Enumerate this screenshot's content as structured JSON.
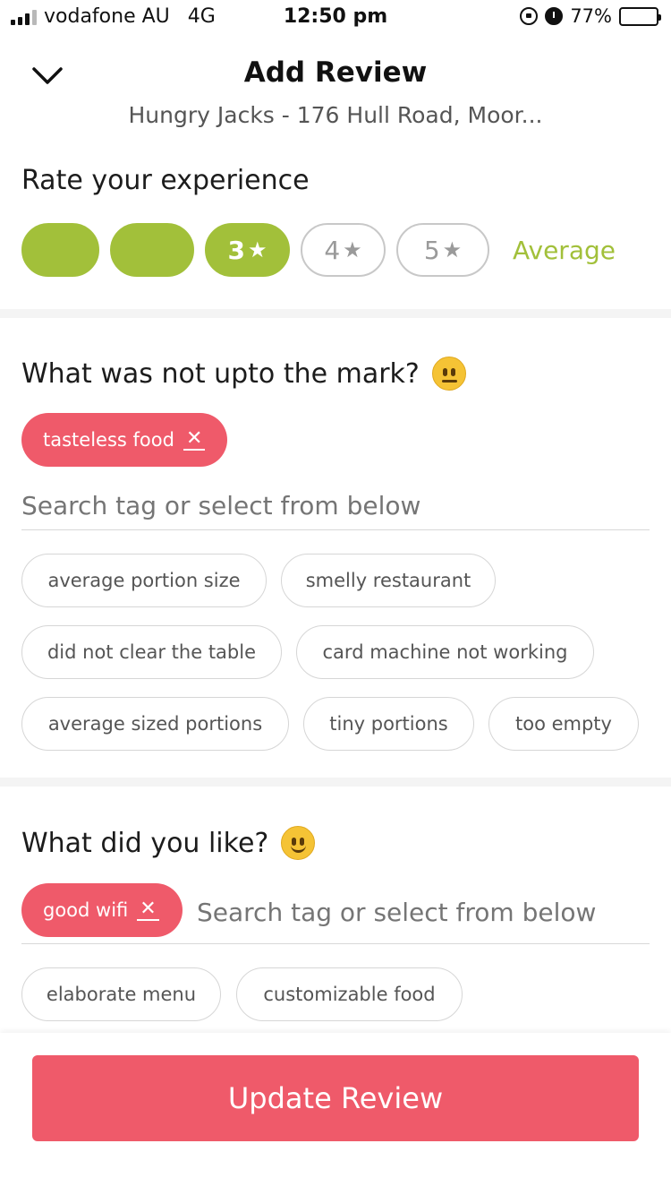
{
  "status_bar": {
    "carrier": "vodafone AU",
    "network": "4G",
    "time": "12:50 pm",
    "battery": "77%",
    "battery_level": 0.77
  },
  "header": {
    "title": "Add Review",
    "subtitle": "Hungry Jacks - 176 Hull Road, Moor..."
  },
  "rating": {
    "heading": "Rate your experience",
    "pills": [
      {
        "label": "",
        "filled": true
      },
      {
        "label": "",
        "filled": true
      },
      {
        "label": "3",
        "filled": true
      },
      {
        "label": "4",
        "filled": false
      },
      {
        "label": "5",
        "filled": false
      }
    ],
    "star_glyph": "★",
    "value_word": "Average",
    "accent_color": "#a2c03a"
  },
  "not_upto_mark": {
    "heading": "What was not upto the mark?",
    "emoji_icon": "neutral-face-icon",
    "selected_tags": [
      {
        "label": "tasteless food"
      }
    ],
    "search_placeholder": "Search tag or select from below",
    "tags": [
      "average portion size",
      "smelly restaurant",
      "did not clear the table",
      "card machine not working",
      "average sized portions",
      "tiny portions",
      "too empty"
    ]
  },
  "liked": {
    "heading": "What did you like?",
    "emoji_icon": "slightly-smiling-face-icon",
    "selected_tags": [
      {
        "label": "good wifi"
      }
    ],
    "search_placeholder": "Search tag or select from below",
    "tags": [
      "elaborate menu",
      "customizable food"
    ]
  },
  "footer": {
    "button_label": "Update Review",
    "button_color": "#ef5a6a"
  },
  "remove_glyph": "✕"
}
